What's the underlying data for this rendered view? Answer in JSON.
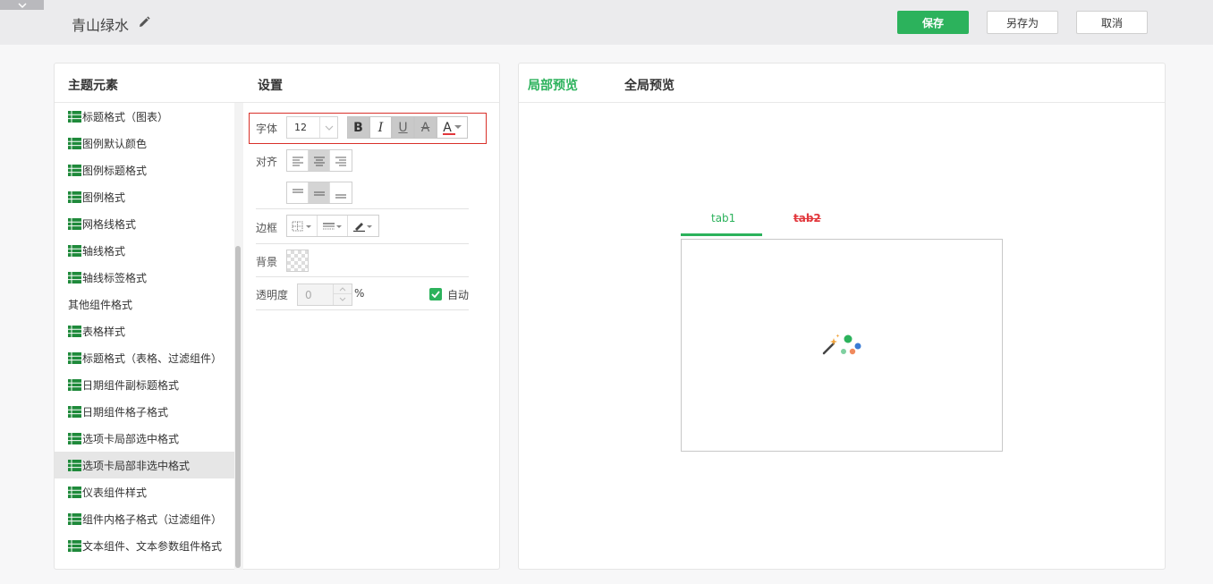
{
  "header": {
    "title": "青山绿水",
    "save_label": "保存",
    "save_as_label": "另存为",
    "cancel_label": "取消"
  },
  "left_panel": {
    "elements_heading": "主题元素",
    "settings_heading": "设置",
    "items": [
      {
        "label": "标题格式（图表）",
        "icon": "table-icon"
      },
      {
        "label": "图例默认颜色",
        "icon": "table-icon"
      },
      {
        "label": "图例标题格式",
        "icon": "table-icon"
      },
      {
        "label": "图例格式",
        "icon": "table-icon"
      },
      {
        "label": "网格线格式",
        "icon": "table-icon"
      },
      {
        "label": "轴线格式",
        "icon": "table-icon"
      },
      {
        "label": "轴线标签格式",
        "icon": "table-icon"
      },
      {
        "label": "其他组件格式",
        "icon": ""
      },
      {
        "label": "表格样式",
        "icon": "table-icon"
      },
      {
        "label": "标题格式（表格、过滤组件）",
        "icon": "table-icon"
      },
      {
        "label": "日期组件副标题格式",
        "icon": "table-icon"
      },
      {
        "label": "日期组件格子格式",
        "icon": "table-icon"
      },
      {
        "label": "选项卡局部选中格式",
        "icon": "table-icon"
      },
      {
        "label": "选项卡局部非选中格式",
        "icon": "table-icon"
      },
      {
        "label": "仪表组件样式",
        "icon": "table-icon"
      },
      {
        "label": "组件内格子格式（过滤组件）",
        "icon": "table-icon"
      },
      {
        "label": "文本组件、文本参数组件格式",
        "icon": "table-icon"
      }
    ],
    "selected_index": 13
  },
  "settings": {
    "font_label": "字体",
    "font_size": "12",
    "bold": "B",
    "italic": "I",
    "underline": "U",
    "strikethrough": "A",
    "font_color_glyph": "A",
    "font_color": "#e2373c",
    "align_label": "对齐",
    "border_label": "边框",
    "background_label": "背景",
    "opacity_label": "透明度",
    "opacity_value": "0",
    "opacity_unit": "%",
    "auto_label": "自动",
    "auto_checked": true
  },
  "right_panel": {
    "local_preview_tab": "局部预览",
    "global_preview_tab": "全局预览",
    "preview_tabs": [
      "tab1",
      "tab2"
    ]
  },
  "colors": {
    "accent": "#2cb25c",
    "highlight_red": "#d9312a"
  }
}
